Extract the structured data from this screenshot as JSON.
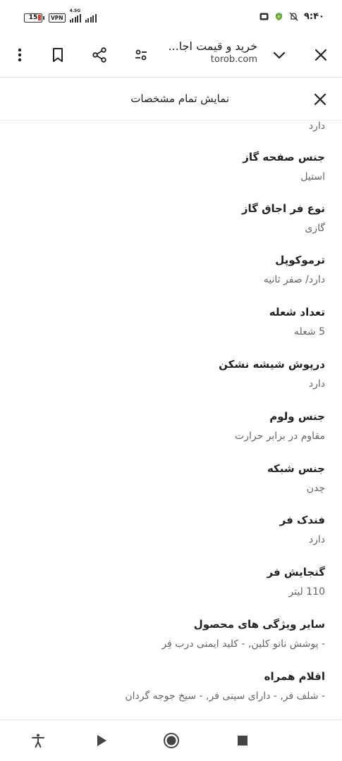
{
  "status_bar": {
    "battery": "15",
    "vpn": "VPN",
    "network": "4.5G",
    "time": "۹:۴۰"
  },
  "toolbar": {
    "title": "خرید و قیمت اجا...",
    "url": "torob.com"
  },
  "panel": {
    "title": "نمایش تمام مشخصات"
  },
  "specs": {
    "first_value": "دارد",
    "items": [
      {
        "label": "جنس صفحه گاز",
        "value": "استیل"
      },
      {
        "label": "نوع فر اجاق گاز",
        "value": "گازی"
      },
      {
        "label": "ترموکوپل",
        "value": "دارد/ صفر ثانیه"
      },
      {
        "label": "تعداد شعله",
        "value": "5 شعله"
      },
      {
        "label": "درپوش شیشه نشکن",
        "value": "دارد"
      },
      {
        "label": "جنس ولوم",
        "value": "مقاوم در برابر حرارت"
      },
      {
        "label": "جنس شبکه",
        "value": "چدن"
      },
      {
        "label": "فندک فر",
        "value": "دارد"
      },
      {
        "label": "گنجایش فر",
        "value": "110 لیتر"
      },
      {
        "label": "سایر ویژگی های محصول",
        "value": "- پوشش نانو کلین, - کلید ایمنی درب فِر"
      },
      {
        "label": "اقلام همراه",
        "value": "- شلف فر, - دارای سینی فر, - سیخ جوجه گردان"
      }
    ]
  },
  "icons": {
    "close": "close-icon",
    "chevron": "chevron-down-icon",
    "tune": "tune-icon",
    "share": "share-icon",
    "bookmark": "bookmark-icon",
    "more": "more-vert-icon",
    "accessibility": "accessibility-icon",
    "back": "nav-back-icon",
    "home": "nav-home-icon",
    "recents": "nav-recents-icon"
  }
}
